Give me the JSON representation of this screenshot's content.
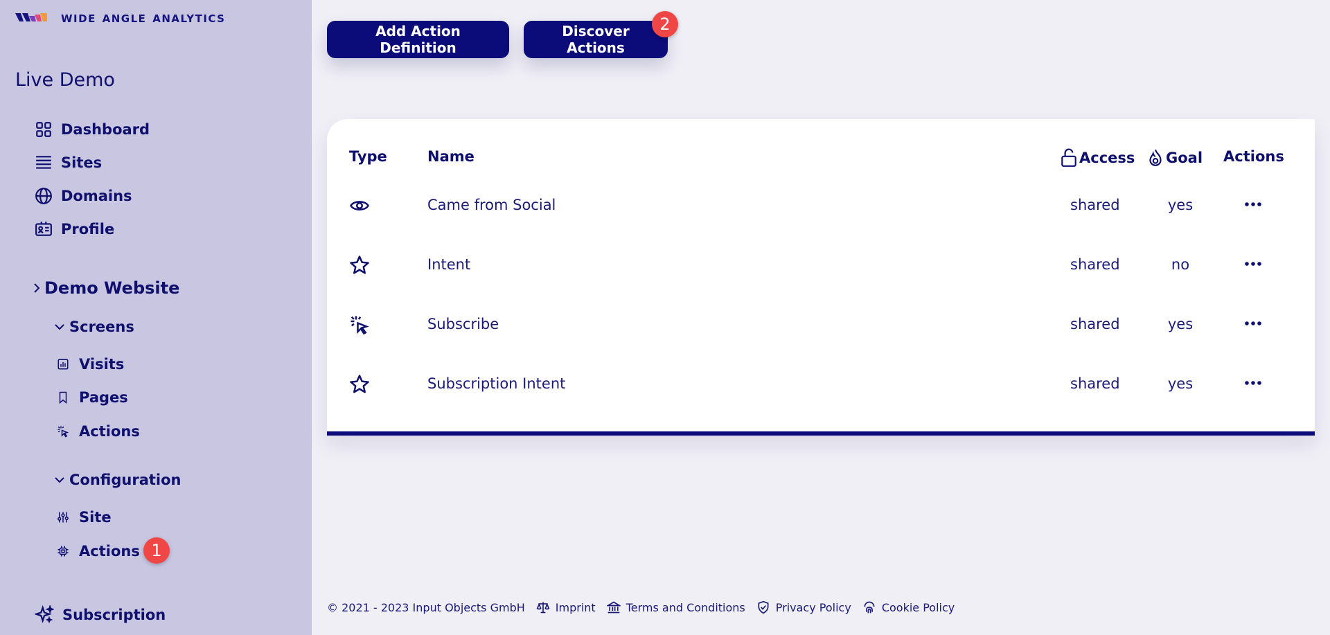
{
  "brand": {
    "name": "wide angle analytics"
  },
  "sidebar": {
    "site_title": "Live Demo",
    "items": [
      {
        "label": "Dashboard",
        "icon": "grid-icon"
      },
      {
        "label": "Sites",
        "icon": "list-icon"
      },
      {
        "label": "Domains",
        "icon": "globe-icon"
      },
      {
        "label": "Profile",
        "icon": "id-card-icon"
      }
    ],
    "website": {
      "label": "Demo Website",
      "screens": {
        "label": "Screens",
        "items": [
          {
            "label": "Visits",
            "icon": "chart-icon"
          },
          {
            "label": "Pages",
            "icon": "bookmark-icon"
          },
          {
            "label": "Actions",
            "icon": "cursor-click-icon"
          }
        ]
      },
      "configuration": {
        "label": "Configuration",
        "items": [
          {
            "label": "Site",
            "icon": "sliders-icon"
          },
          {
            "label": "Actions",
            "icon": "chip-icon"
          }
        ]
      }
    },
    "subscription": {
      "label": "Subscription",
      "icon": "sparkles-icon"
    },
    "badge": "1"
  },
  "toolbar": {
    "add_label": "Add Action Definition",
    "discover_label": "Discover Actions",
    "discover_badge": "2"
  },
  "table": {
    "headers": {
      "type": "Type",
      "name": "Name",
      "access": "Access",
      "goal": "Goal",
      "actions": "Actions"
    },
    "rows": [
      {
        "type_icon": "eye-icon",
        "name": "Came from Social",
        "access": "shared",
        "goal": "yes"
      },
      {
        "type_icon": "star-icon",
        "name": "Intent",
        "access": "shared",
        "goal": "no"
      },
      {
        "type_icon": "cursor-click-icon",
        "name": "Subscribe",
        "access": "shared",
        "goal": "yes"
      },
      {
        "type_icon": "star-icon",
        "name": "Subscription Intent",
        "access": "shared",
        "goal": "yes"
      }
    ]
  },
  "footer": {
    "copyright": "© 2021 - 2023 Input Objects GmbH",
    "imprint": "Imprint",
    "terms": "Terms and Conditions",
    "privacy": "Privacy Policy",
    "cookie": "Cookie Policy"
  },
  "colors": {
    "accent": "#0b0b7a",
    "badge": "#f04646",
    "sidebar": "#c9c6e1",
    "background": "#f0eff6"
  }
}
